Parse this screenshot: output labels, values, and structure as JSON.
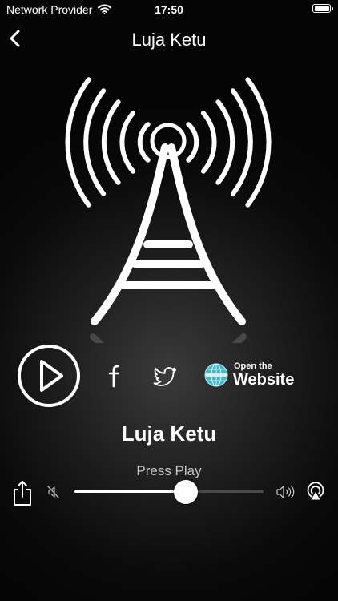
{
  "status_bar": {
    "carrier": "Network Provider",
    "time": "17:50"
  },
  "nav": {
    "title": "Luja Ketu",
    "back_icon": "chevron-left-icon"
  },
  "hero": {
    "icon": "radio-tower-icon"
  },
  "actions": {
    "play_icon": "play-icon",
    "facebook_icon": "facebook-icon",
    "twitter_icon": "twitter-icon",
    "website_small": "Open the",
    "website_big": "Website"
  },
  "player": {
    "station_name": "Luja Ketu",
    "status_text": "Press Play",
    "volume_level": 0.59,
    "share_icon": "share-icon",
    "mute_icon": "speaker-mute-icon",
    "volume_icon": "speaker-wave-icon",
    "airplay_icon": "airplay-icon"
  },
  "colors": {
    "text": "#ffffff",
    "secondary_text": "#c8c8c8",
    "track_inactive": "#4a4a4a",
    "background": "#0a0a0a"
  }
}
